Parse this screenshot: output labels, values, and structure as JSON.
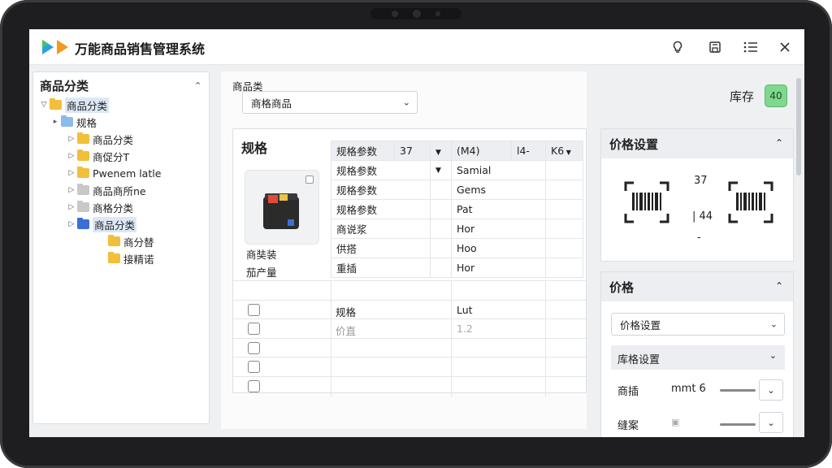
{
  "window": {
    "title": "万能商品销售管理系统",
    "icons": [
      "bulb-icon",
      "save-icon",
      "list-settings-icon",
      "close-icon"
    ]
  },
  "tree": {
    "heading": "商品分类",
    "items": [
      {
        "label": "商品分类",
        "level": 0,
        "arrow": "▽",
        "color": "#f2bf3a",
        "selected": true
      },
      {
        "label": "规格",
        "level": 1,
        "arrow": "▸",
        "color": "#8bbbe8"
      },
      {
        "label": "商品分类",
        "level": 2,
        "arrow": "▷",
        "color": "#f2bf3a"
      },
      {
        "label": "商促分T",
        "level": 2,
        "arrow": "▷",
        "color": "#f2bf3a"
      },
      {
        "label": "Pwenem latle",
        "level": 2,
        "arrow": "▷",
        "color": "#f2bf3a"
      },
      {
        "label": "商品商所ne",
        "level": 2,
        "arrow": "▷",
        "color": "#c8c8c8"
      },
      {
        "label": "商格分类",
        "level": 2,
        "arrow": "▷",
        "color": "#c8c8c8"
      },
      {
        "label": "商品分类",
        "level": 2,
        "arrow": "▷",
        "color": "#3b6fd6",
        "selected": true
      },
      {
        "label": "商分替",
        "level": 3,
        "arrow": "",
        "color": "#f2bf3a"
      },
      {
        "label": "接精诺",
        "level": 3,
        "arrow": "",
        "color": "#f2bf3a"
      }
    ]
  },
  "category": {
    "label": "商品类",
    "value": "商格商品"
  },
  "spec": {
    "title": "规格",
    "thumb_labels": [
      "商奘装",
      "茄产量"
    ],
    "headers": [
      "规格参数",
      "37",
      "",
      "(M4)",
      "l4-",
      "K6"
    ],
    "rows": [
      [
        "规格参数",
        "Samial"
      ],
      [
        "规格参数",
        "Gems"
      ],
      [
        "规格参数",
        "Pat"
      ],
      [
        "商说浆",
        "Hor"
      ],
      [
        "供搭",
        "Hoo"
      ],
      [
        "重插",
        "Hor"
      ]
    ],
    "lower_rows": [
      [
        "",
        ""
      ],
      [
        "规格",
        "Lut"
      ],
      [
        "价直",
        "1.2"
      ],
      [
        "",
        ""
      ],
      [
        "",
        ""
      ],
      [
        "",
        ""
      ]
    ]
  },
  "stock": {
    "label": "库存",
    "badge": "40"
  },
  "price_settings": {
    "title": "价格设置",
    "num_top": "37",
    "num_mid": "44",
    "num_bottom": "-"
  },
  "price": {
    "title": "价格",
    "dropdown": "价格设置",
    "sub_title": "库格设置",
    "rows": [
      {
        "label": "商插",
        "value": "mmt 6"
      },
      {
        "label": "缝案",
        "value": ""
      }
    ]
  }
}
